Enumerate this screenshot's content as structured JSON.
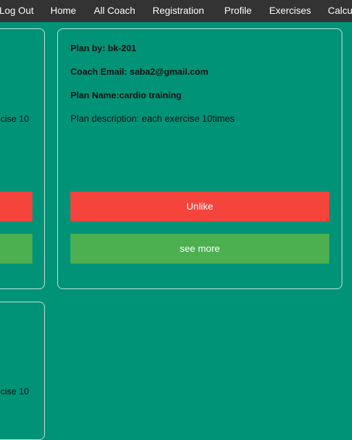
{
  "nav": {
    "items": [
      {
        "label": "Log Out"
      },
      {
        "label": "Home"
      },
      {
        "label": "All Coach"
      },
      {
        "label": "Registration"
      },
      {
        "label": "Profile"
      },
      {
        "label": "Exercises"
      },
      {
        "label": "Calcu"
      }
    ]
  },
  "cards": {
    "left_top": {
      "description_fragment": "cise 10"
    },
    "left_bottom": {
      "description_fragment": "cise 10"
    },
    "main": {
      "plan_by": "Plan by: bk-201",
      "coach_email": "Coach Email: saba2@gmail.com",
      "plan_name": "Plan Name:cardio training",
      "description": "Plan description: each exercise 10times",
      "unlike_label": "Unlike",
      "see_more_label": "see more"
    }
  },
  "colors": {
    "background": "#009378",
    "navbar": "#333333",
    "unlike": "#f5443b",
    "see_more": "#4caf50",
    "card_border": "#c9e4de"
  }
}
